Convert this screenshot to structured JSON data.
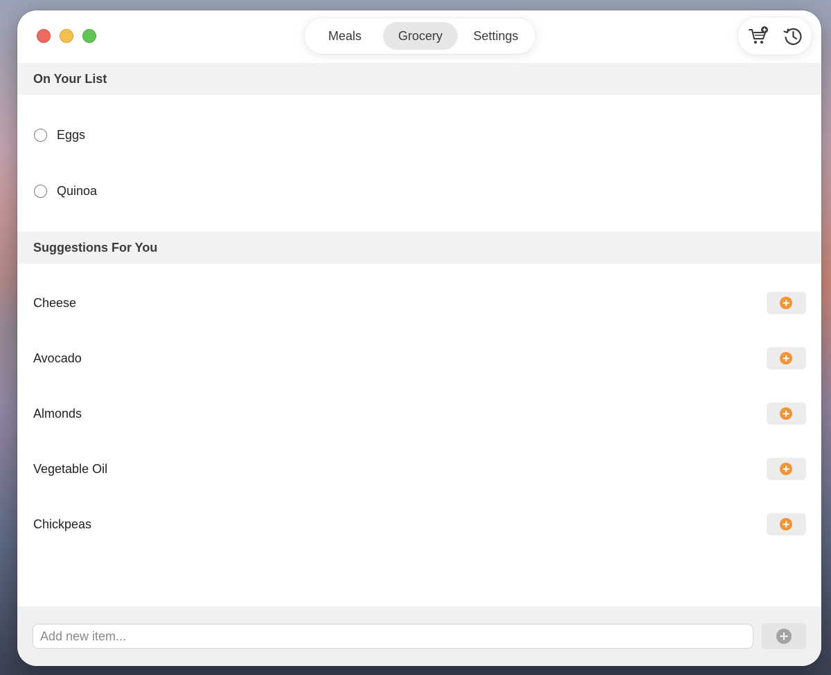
{
  "window": {
    "tabs": [
      {
        "label": "Meals",
        "active": false
      },
      {
        "label": "Grocery",
        "active": true
      },
      {
        "label": "Settings",
        "active": false
      }
    ],
    "toolbar": {
      "cart_icon": "cart-add-icon",
      "history_icon": "history-icon"
    }
  },
  "list_section": {
    "title": "On Your List",
    "items": [
      {
        "label": "Eggs",
        "checked": false
      },
      {
        "label": "Quinoa",
        "checked": false
      }
    ]
  },
  "suggestions_section": {
    "title": "Suggestions For You",
    "items": [
      {
        "label": "Cheese"
      },
      {
        "label": "Avocado"
      },
      {
        "label": "Almonds"
      },
      {
        "label": "Vegetable Oil"
      },
      {
        "label": "Chickpeas"
      }
    ]
  },
  "footer": {
    "input_placeholder": "Add new item...",
    "input_value": ""
  },
  "colors": {
    "accent": "#f0953a",
    "close": "#ed6a5e",
    "minimize": "#f4bf4f",
    "maximize": "#61c554"
  }
}
